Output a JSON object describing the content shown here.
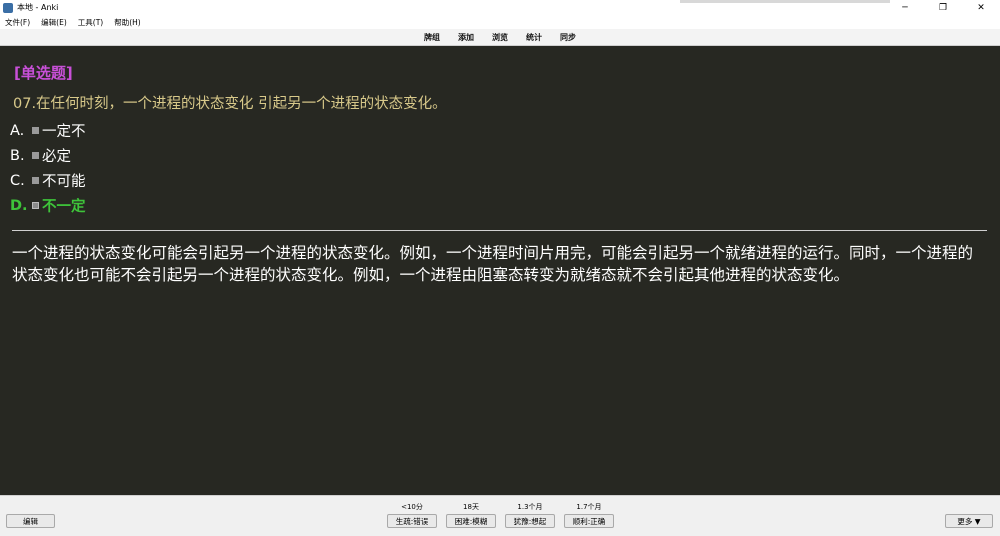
{
  "window": {
    "title": "本地 - Anki",
    "minimize": "─",
    "maximize": "❐",
    "close": "✕"
  },
  "menu": [
    "文件(F)",
    "编辑(E)",
    "工具(T)",
    "帮助(H)"
  ],
  "toolbar": [
    "牌组",
    "添加",
    "浏览",
    "统计",
    "同步"
  ],
  "card": {
    "question_type": "[单选题]",
    "question": "07.在任何时刻，一个进程的状态变化  引起另一个进程的状态变化。",
    "options": [
      {
        "letter": "A.",
        "text": "一定不"
      },
      {
        "letter": "B.",
        "text": "必定"
      },
      {
        "letter": "C.",
        "text": "不可能"
      },
      {
        "letter": "D.",
        "text": "不一定"
      }
    ],
    "correct_index": 3,
    "explanation": "一个进程的状态变化可能会引起另一个进程的状态变化。例如，一个进程时间片用完，可能会引起另一个就绪进程的运行。同时，一个进程的状态变化也可能不会引起另一个进程的状态变化。例如，一个进程由阻塞态转变为就绪态就不会引起其他进程的状态变化。"
  },
  "bottom": {
    "edit_label": "编辑",
    "more_label": "更多 ▼",
    "answers": [
      {
        "interval": "<10分",
        "label": "生疏:错误"
      },
      {
        "interval": "18天",
        "label": "困难:模糊"
      },
      {
        "interval": "1.3个月",
        "label": "犹豫:想起"
      },
      {
        "interval": "1.7个月",
        "label": "顺利:正确"
      }
    ]
  },
  "colors": {
    "card_bg": "#272822",
    "question_type": "#c850d8",
    "question": "#d8c98a",
    "correct": "#3ec43a"
  }
}
